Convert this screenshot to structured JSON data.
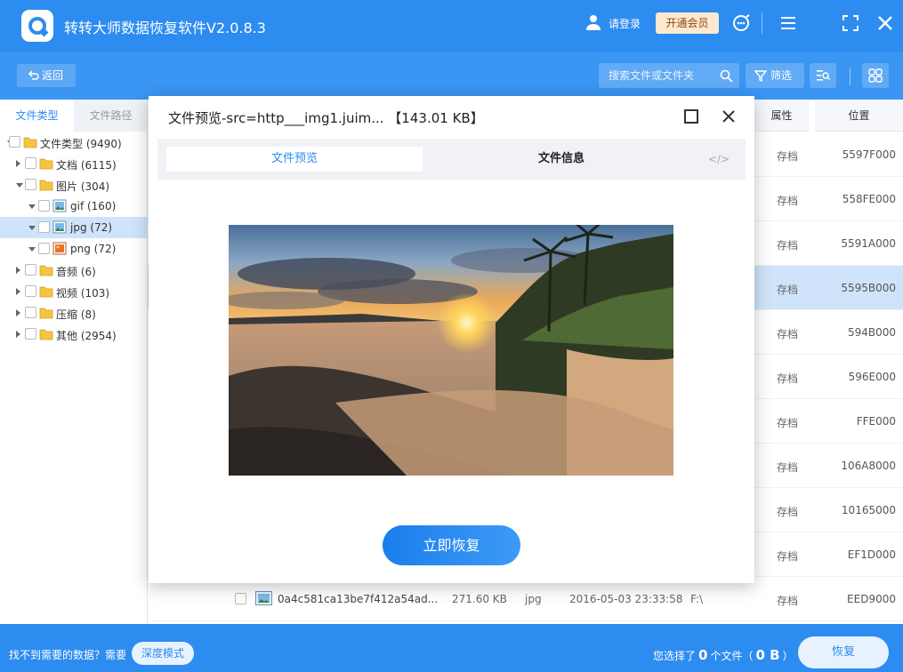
{
  "app": {
    "title": "转转大师数据恢复软件V2.0.8.3",
    "login": "请登录",
    "vip": "开通会员"
  },
  "toolbar": {
    "back": "返回",
    "search_placeholder": "搜索文件或文件夹",
    "filter": "筛选"
  },
  "sidebar": {
    "tabs": [
      "文件类型",
      "文件路径"
    ],
    "tree": [
      {
        "label": "文件类型 (9490)",
        "icon": "folder-icon",
        "level": 0,
        "expanded": true
      },
      {
        "label": "文档 (6115)",
        "icon": "folder-icon",
        "level": 1,
        "expanded": false
      },
      {
        "label": "图片 (304)",
        "icon": "folder-icon",
        "level": 1,
        "expanded": true
      },
      {
        "label": "gif (160)",
        "icon": "image-file-icon",
        "level": 2,
        "expanded": true
      },
      {
        "label": "jpg (72)",
        "icon": "image-file-icon",
        "level": 2,
        "expanded": true,
        "selected": true
      },
      {
        "label": "png (72)",
        "icon": "png-file-icon",
        "level": 2,
        "expanded": true
      },
      {
        "label": "音频 (6)",
        "icon": "folder-icon",
        "level": 1,
        "expanded": false
      },
      {
        "label": "视频 (103)",
        "icon": "folder-icon",
        "level": 1,
        "expanded": false
      },
      {
        "label": "压缩 (8)",
        "icon": "folder-icon",
        "level": 1,
        "expanded": false
      },
      {
        "label": "其他 (2954)",
        "icon": "folder-icon",
        "level": 1,
        "expanded": false
      }
    ]
  },
  "list": {
    "headers": {
      "attr": "属性",
      "pos": "位置"
    },
    "rows": [
      {
        "attr": "存档",
        "pos": "5597F000"
      },
      {
        "attr": "存档",
        "pos": "558FE000"
      },
      {
        "attr": "存档",
        "pos": "5591A000"
      },
      {
        "attr": "存档",
        "pos": "5595B000",
        "highlight": true
      },
      {
        "attr": "存档",
        "pos": "594B000"
      },
      {
        "attr": "存档",
        "pos": "596E000"
      },
      {
        "attr": "存档",
        "pos": "FFE000"
      },
      {
        "attr": "存档",
        "pos": "106A8000"
      },
      {
        "attr": "存档",
        "pos": "10165000"
      },
      {
        "attr": "存档",
        "pos": "EF1D000"
      }
    ],
    "last_row": {
      "name": "0a4c581ca13be7f412a54ad...",
      "size": "271.60 KB",
      "type": "jpg",
      "date": "2016-05-03 23:33:58",
      "path": "F:\\",
      "attr": "存档",
      "pos": "EED9000"
    }
  },
  "modal": {
    "title": "文件预览-src=http___img1.juim... 【143.01 KB】",
    "tab_preview": "文件预览",
    "tab_info": "文件信息",
    "tab_code": "</>",
    "restore": "立即恢复"
  },
  "bottom": {
    "tip": "找不到需要的数据？需要",
    "deep_mode": "深度模式",
    "sel_prefix": "您选择了",
    "sel_count": "0",
    "sel_mid": "个文件（",
    "sel_size": "0 B",
    "sel_suffix": "）",
    "recover": "恢复"
  },
  "colors": {
    "primary": "#2d8cf0",
    "toolbar": "#3a95f3",
    "selected_row": "#cfe4fb"
  }
}
